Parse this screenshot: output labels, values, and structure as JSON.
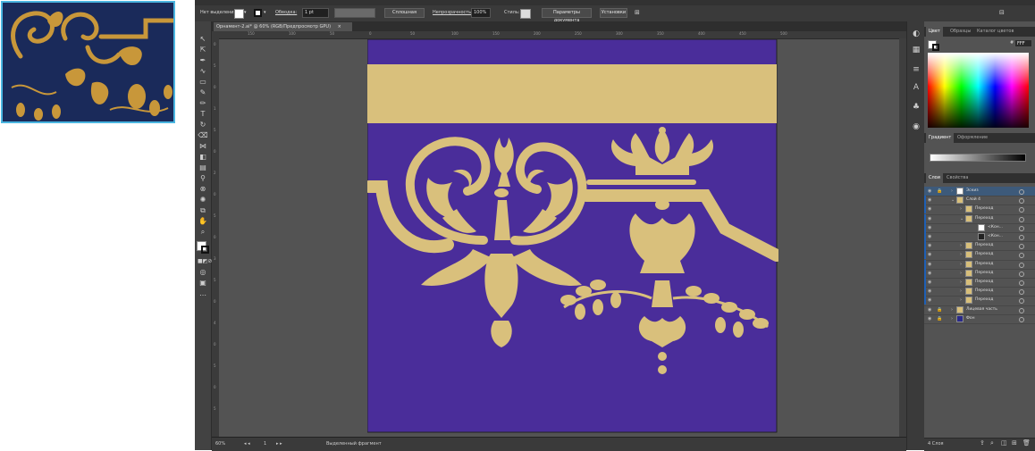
{
  "colors": {
    "artboard_bg": "#4a2d9a",
    "ornament_gold": "#d9c07c",
    "reference_gold": "#c8973a",
    "reference_navy": "#1a2a5a",
    "ui_dark": "#323232",
    "ui_panel": "#535353",
    "accent_layer": "#1e5fb4"
  },
  "control_bar": {
    "selection_label": "Нет выделения",
    "stroke_label": "Обводка:",
    "stroke_value": "1 pt",
    "brush_label": "Сплошная",
    "opacity_label": "Непрозрачность:",
    "opacity_value": "100%",
    "style_label": "Стиль:",
    "doc_settings_button": "Параметры документа",
    "preferences_button": "Установки"
  },
  "document": {
    "tab_title": "Орнамент-2.ai* @ 60% (RGB/Предпросмотр GPU)",
    "close_glyph": "×"
  },
  "rulers": {
    "h_labels": [
      "150",
      "100",
      "50",
      "0",
      "50",
      "100",
      "150",
      "200",
      "250",
      "300",
      "350",
      "400",
      "450",
      "500"
    ],
    "v_labels": [
      "0",
      "5",
      "0",
      "1",
      "5",
      "0",
      "2",
      "0",
      "5",
      "0",
      "3",
      "5",
      "0",
      "4",
      "0",
      "5",
      "0",
      "5"
    ]
  },
  "status": {
    "zoom": "60%",
    "artboard_index": "1",
    "selection_tool": "Выделенный фрагмент"
  },
  "panels": {
    "color_tabs": [
      "Цвет",
      "Образцы",
      "Каталог цветов"
    ],
    "hex_prefix": "#",
    "hex_value": "FFF",
    "gradient_tabs": [
      "Градиент",
      "Оформление"
    ],
    "layer_tabs": [
      "Слои",
      "Свойства"
    ],
    "layers": [
      {
        "name": "Эскиз",
        "indent": 0,
        "expandable": true,
        "locked": true,
        "selected": true
      },
      {
        "name": "Слой 4",
        "indent": 0,
        "expandable": true,
        "locked": false,
        "selected": false
      },
      {
        "name": "Переход",
        "indent": 1,
        "expandable": true,
        "locked": false,
        "selected": false
      },
      {
        "name": "Переход",
        "indent": 1,
        "expandable": true,
        "locked": false,
        "selected": false
      },
      {
        "name": "<Кон...",
        "indent": 2,
        "expandable": false,
        "locked": false,
        "selected": false
      },
      {
        "name": "<Кон...",
        "indent": 2,
        "expandable": false,
        "locked": false,
        "selected": false
      },
      {
        "name": "Переход",
        "indent": 1,
        "expandable": true,
        "locked": false,
        "selected": false
      },
      {
        "name": "Переход",
        "indent": 1,
        "expandable": true,
        "locked": false,
        "selected": false
      },
      {
        "name": "Переход",
        "indent": 1,
        "expandable": true,
        "locked": false,
        "selected": false
      },
      {
        "name": "Переход",
        "indent": 1,
        "expandable": true,
        "locked": false,
        "selected": false
      },
      {
        "name": "Переход",
        "indent": 1,
        "expandable": true,
        "locked": false,
        "selected": false
      },
      {
        "name": "Переход",
        "indent": 1,
        "expandable": true,
        "locked": false,
        "selected": false
      },
      {
        "name": "Переход",
        "indent": 1,
        "expandable": true,
        "locked": false,
        "selected": false
      },
      {
        "name": "Лицевая часть",
        "indent": 0,
        "expandable": true,
        "locked": true,
        "selected": false
      },
      {
        "name": "Фон",
        "indent": 0,
        "expandable": true,
        "locked": true,
        "selected": false
      }
    ],
    "layers_count": "4 Слоя"
  }
}
